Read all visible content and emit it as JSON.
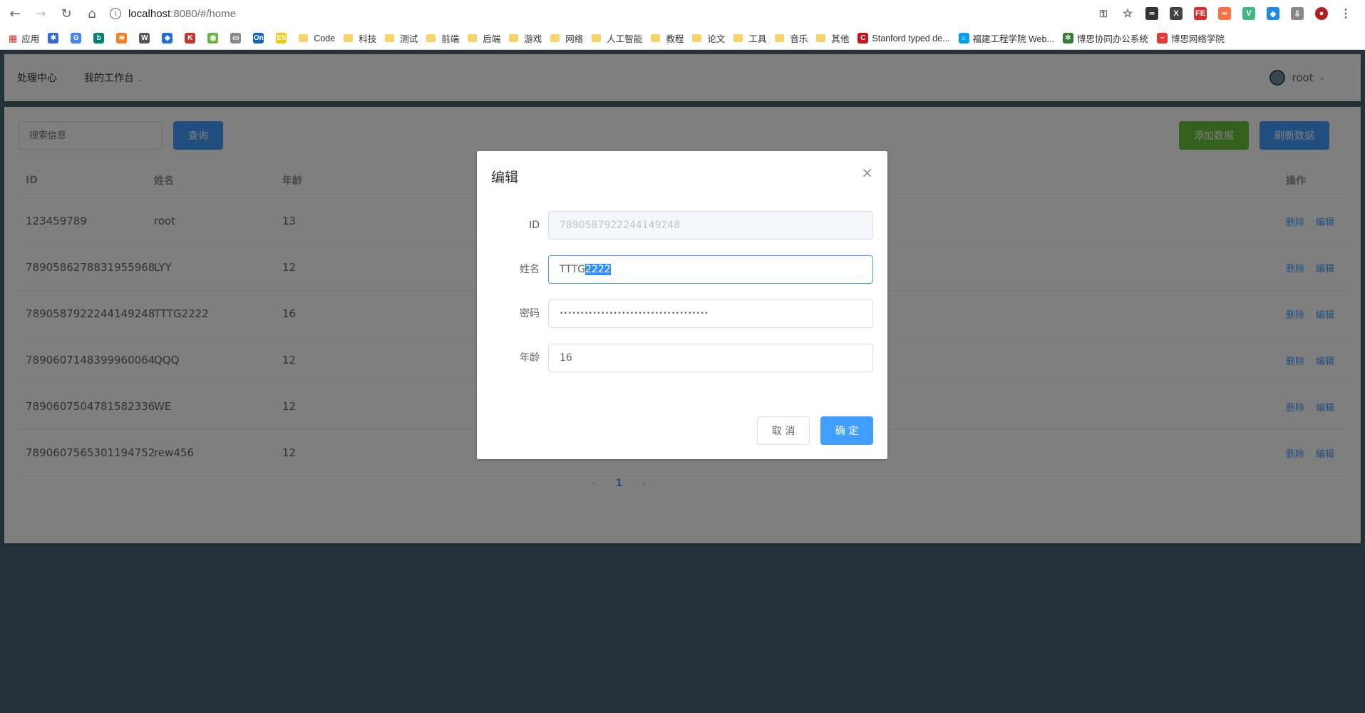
{
  "browser": {
    "url_host": "localhost",
    "url_path": ":8080/#/home",
    "bookmarks": [
      {
        "label": "应用",
        "kind": "apps"
      },
      {
        "label": "",
        "kind": "fav",
        "color": "#3367d6",
        "glyph": "✱"
      },
      {
        "label": "",
        "kind": "fav",
        "color": "#4285f4",
        "glyph": "G"
      },
      {
        "label": "",
        "kind": "fav",
        "color": "#008373",
        "glyph": "b"
      },
      {
        "label": "",
        "kind": "fav",
        "color": "#f48024",
        "glyph": "≋"
      },
      {
        "label": "",
        "kind": "fav",
        "color": "#555555",
        "glyph": "W"
      },
      {
        "label": "",
        "kind": "fav",
        "color": "#1e6fd9",
        "glyph": "◆"
      },
      {
        "label": "",
        "kind": "fav",
        "color": "#c0392b",
        "glyph": "K"
      },
      {
        "label": "",
        "kind": "fav",
        "color": "#6db33f",
        "glyph": "◉"
      },
      {
        "label": "",
        "kind": "fav",
        "color": "#888888",
        "glyph": "▭"
      },
      {
        "label": "",
        "kind": "fav",
        "color": "#1565c0",
        "glyph": "On"
      },
      {
        "label": "",
        "kind": "fav",
        "color": "#f2c811",
        "glyph": "ES"
      },
      {
        "label": "Code",
        "kind": "folder"
      },
      {
        "label": "科技",
        "kind": "folder"
      },
      {
        "label": "测试",
        "kind": "folder"
      },
      {
        "label": "前端",
        "kind": "folder"
      },
      {
        "label": "后端",
        "kind": "folder"
      },
      {
        "label": "游戏",
        "kind": "folder"
      },
      {
        "label": "网络",
        "kind": "folder"
      },
      {
        "label": "人工智能",
        "kind": "folder"
      },
      {
        "label": "教程",
        "kind": "folder"
      },
      {
        "label": "论文",
        "kind": "folder"
      },
      {
        "label": "工具",
        "kind": "folder"
      },
      {
        "label": "音乐",
        "kind": "folder"
      },
      {
        "label": "其他",
        "kind": "folder"
      },
      {
        "label": "Stanford typed de...",
        "kind": "fav",
        "color": "#c4161c",
        "glyph": "C"
      },
      {
        "label": "福建工程学院 Web...",
        "kind": "fav",
        "color": "#00a0e9",
        "glyph": "⌂"
      },
      {
        "label": "博思协同办公系统",
        "kind": "fav",
        "color": "#2e7d32",
        "glyph": "✲"
      },
      {
        "label": "博思网络学院",
        "kind": "fav",
        "color": "#e53935",
        "glyph": "~"
      }
    ]
  },
  "nav": {
    "item1": "处理中心",
    "item2": "我的工作台",
    "user": "root"
  },
  "toolbar": {
    "search_placeholder": "搜索信息",
    "query_label": "查询",
    "add_label": "添加数据",
    "refresh_label": "刷新数据"
  },
  "table": {
    "headers": {
      "id": "ID",
      "name": "姓名",
      "age": "年龄",
      "op": "操作"
    },
    "delete_label": "删除",
    "edit_label": "编辑",
    "rows": [
      {
        "id": "123459789",
        "name": "root",
        "age": "13"
      },
      {
        "id": "7890586278831955968",
        "name": "LYY",
        "age": "12"
      },
      {
        "id": "7890587922244149248",
        "name": "TTTG2222",
        "age": "16"
      },
      {
        "id": "7890607148399960064",
        "name": "QQQ",
        "age": "12"
      },
      {
        "id": "7890607504781582336",
        "name": "WE",
        "age": "12"
      },
      {
        "id": "7890607565301194752",
        "name": "rew456",
        "age": "12"
      }
    ]
  },
  "pager": {
    "prev": "‹",
    "current": "1",
    "next": "›"
  },
  "dialog": {
    "title": "编辑",
    "close": "×",
    "id_label": "ID",
    "id_value": "7890587922244149248",
    "name_label": "姓名",
    "name_value_plain": "TTTG",
    "name_value_selected": "2222",
    "password_label": "密码",
    "password_value": "••••••••••••••••••••••••••••••••••••",
    "age_label": "年龄",
    "age_value": "16",
    "cancel_label": "取 消",
    "confirm_label": "确 定"
  }
}
